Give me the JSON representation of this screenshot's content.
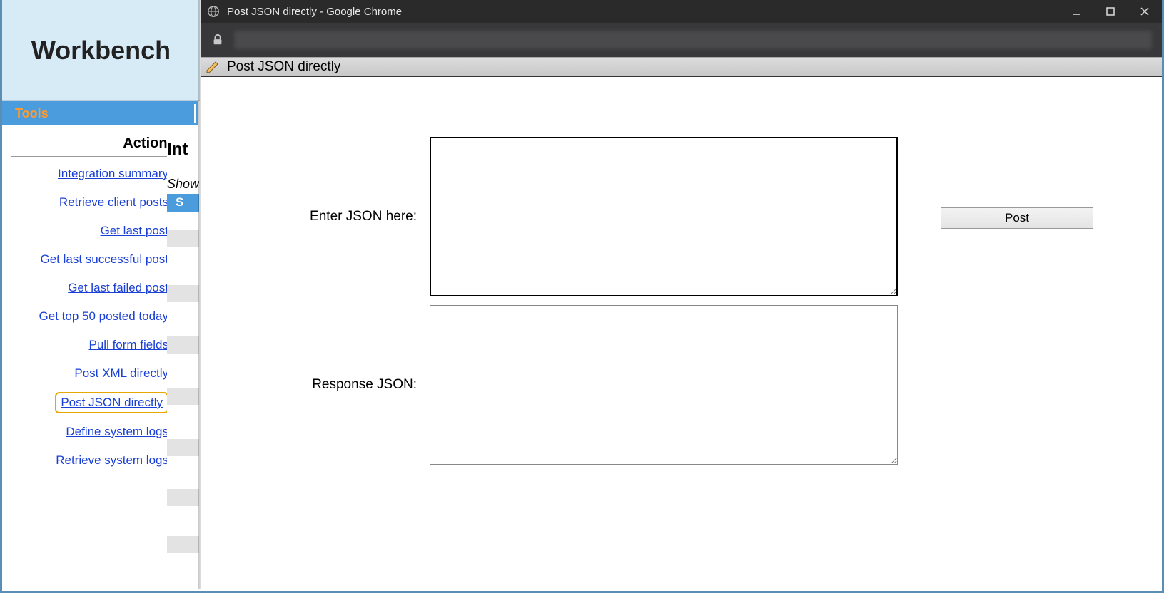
{
  "sidebar": {
    "title": "Workbench",
    "tools_label": "Tools",
    "actions_header": "Actions",
    "items": [
      {
        "label": "Integration summary"
      },
      {
        "label": "Retrieve client posts"
      },
      {
        "label": "Get last post"
      },
      {
        "label": "Get last successful post"
      },
      {
        "label": "Get last failed post"
      },
      {
        "label": "Get top 50 posted today"
      },
      {
        "label": "Pull form fields"
      },
      {
        "label": "Post XML directly"
      },
      {
        "label": "Post JSON directly"
      },
      {
        "label": "Define system logs"
      },
      {
        "label": "Retrieve system logs"
      }
    ],
    "highlighted_index": 8
  },
  "obscured": {
    "heading_partial": "Int",
    "show_partial": "Show",
    "blue_row_partial": "S"
  },
  "chrome": {
    "window_title": "Post JSON directly - Google Chrome",
    "page_tab_title": "Post JSON directly"
  },
  "form": {
    "enter_label": "Enter JSON here:",
    "response_label": "Response JSON:",
    "enter_value": "",
    "response_value": "",
    "post_button": "Post"
  }
}
